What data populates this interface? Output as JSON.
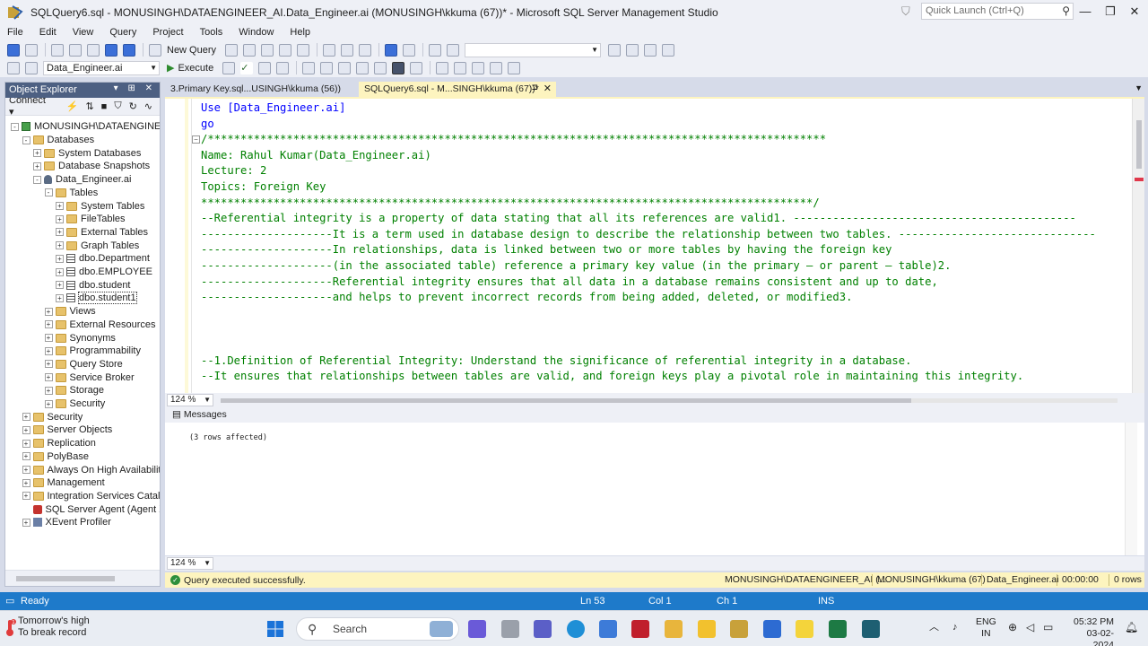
{
  "window": {
    "title": "SQLQuery6.sql - MONUSINGH\\DATAENGINEER_AI.Data_Engineer.ai (MONUSINGH\\kkuma (67))* - Microsoft SQL Server Management Studio",
    "quick_launch_placeholder": "Quick Launch (Ctrl+Q)"
  },
  "menu": [
    "File",
    "Edit",
    "View",
    "Query",
    "Project",
    "Tools",
    "Window",
    "Help"
  ],
  "toolbar": {
    "new_query_label": "New Query",
    "database_selected": "Data_Engineer.ai",
    "execute_label": "Execute"
  },
  "object_explorer": {
    "title": "Object Explorer",
    "connect_label": "Connect",
    "tree": [
      {
        "label": "MONUSINGH\\DATAENGINEER_AI",
        "icon": "server-icon",
        "exp": "-",
        "level": 0
      },
      {
        "label": "Databases",
        "icon": "folder-icon",
        "exp": "-",
        "level": 1
      },
      {
        "label": "System Databases",
        "icon": "folder-icon",
        "exp": "+",
        "level": 2
      },
      {
        "label": "Database Snapshots",
        "icon": "folder-icon",
        "exp": "+",
        "level": 2
      },
      {
        "label": "Data_Engineer.ai",
        "icon": "database-icon",
        "exp": "-",
        "level": 2
      },
      {
        "label": "Tables",
        "icon": "folder-icon",
        "exp": "-",
        "level": 3
      },
      {
        "label": "System Tables",
        "icon": "folder-icon",
        "exp": "+",
        "level": 4
      },
      {
        "label": "FileTables",
        "icon": "folder-icon",
        "exp": "+",
        "level": 4
      },
      {
        "label": "External Tables",
        "icon": "folder-icon",
        "exp": "+",
        "level": 4
      },
      {
        "label": "Graph Tables",
        "icon": "folder-icon",
        "exp": "+",
        "level": 4
      },
      {
        "label": "dbo.Department",
        "icon": "table-icon",
        "exp": "+",
        "level": 4
      },
      {
        "label": "dbo.EMPLOYEE",
        "icon": "table-icon",
        "exp": "+",
        "level": 4
      },
      {
        "label": "dbo.student",
        "icon": "table-icon",
        "exp": "+",
        "level": 4
      },
      {
        "label": "dbo.student1",
        "icon": "table-icon",
        "exp": "+",
        "level": 4,
        "selected": true
      },
      {
        "label": "Views",
        "icon": "folder-icon",
        "exp": "+",
        "level": 3
      },
      {
        "label": "External Resources",
        "icon": "folder-icon",
        "exp": "+",
        "level": 3
      },
      {
        "label": "Synonyms",
        "icon": "folder-icon",
        "exp": "+",
        "level": 3
      },
      {
        "label": "Programmability",
        "icon": "folder-icon",
        "exp": "+",
        "level": 3
      },
      {
        "label": "Query Store",
        "icon": "folder-icon",
        "exp": "+",
        "level": 3
      },
      {
        "label": "Service Broker",
        "icon": "folder-icon",
        "exp": "+",
        "level": 3
      },
      {
        "label": "Storage",
        "icon": "folder-icon",
        "exp": "+",
        "level": 3
      },
      {
        "label": "Security",
        "icon": "folder-icon",
        "exp": "+",
        "level": 3
      },
      {
        "label": "Security",
        "icon": "folder-icon",
        "exp": "+",
        "level": 1
      },
      {
        "label": "Server Objects",
        "icon": "folder-icon",
        "exp": "+",
        "level": 1
      },
      {
        "label": "Replication",
        "icon": "folder-icon",
        "exp": "+",
        "level": 1
      },
      {
        "label": "PolyBase",
        "icon": "folder-icon",
        "exp": "+",
        "level": 1
      },
      {
        "label": "Always On High Availability",
        "icon": "folder-icon",
        "exp": "+",
        "level": 1
      },
      {
        "label": "Management",
        "icon": "folder-icon",
        "exp": "+",
        "level": 1
      },
      {
        "label": "Integration Services Catalogs",
        "icon": "folder-icon",
        "exp": "+",
        "level": 1
      },
      {
        "label": "SQL Server Agent (Agent XPs di",
        "icon": "agent-icon",
        "exp": "",
        "level": 1
      },
      {
        "label": "XEvent Profiler",
        "icon": "xevent-icon",
        "exp": "+",
        "level": 1
      }
    ]
  },
  "tabs": [
    {
      "label": "3.Primary Key.sql...USINGH\\kkuma (56))"
    },
    {
      "label": "SQLQuery6.sql - M...SINGH\\kkuma (67))*"
    }
  ],
  "editor": {
    "lines": [
      {
        "parts": [
          {
            "t": "Use [Data_Engineer.ai]",
            "c": "kw"
          }
        ]
      },
      {
        "parts": [
          {
            "t": "go",
            "c": "kw"
          }
        ]
      },
      {
        "parts": [
          {
            "t": "/**********************************************************************************************",
            "c": "cm"
          }
        ],
        "fold": true
      },
      {
        "parts": [
          {
            "t": "Name: Rahul Kumar(Data_Engineer.ai)",
            "c": "cm"
          }
        ]
      },
      {
        "parts": [
          {
            "t": "Lecture: 2",
            "c": "cm"
          }
        ]
      },
      {
        "parts": [
          {
            "t": "Topics: Foreign Key",
            "c": "cm"
          }
        ]
      },
      {
        "parts": [
          {
            "t": "*********************************************************************************************/",
            "c": "cm"
          }
        ]
      },
      {
        "parts": [
          {
            "t": "--Referential integrity is a property of data stating that all its references are valid1. -------------------------------------------",
            "c": "cm"
          }
        ]
      },
      {
        "parts": [
          {
            "t": "--------------------It is a term used in database design to describe the relationship between two tables. ------------------------------",
            "c": "cm"
          }
        ]
      },
      {
        "parts": [
          {
            "t": "--------------------In relationships, data is linked between two or more tables by having the foreign key",
            "c": "cm"
          }
        ]
      },
      {
        "parts": [
          {
            "t": "--------------------(in the associated table) reference a primary key value (in the primary – or parent – table)2.",
            "c": "cm"
          }
        ]
      },
      {
        "parts": [
          {
            "t": "--------------------Referential integrity ensures that all data in a database remains consistent and up to date,",
            "c": "cm"
          }
        ]
      },
      {
        "parts": [
          {
            "t": "--------------------and helps to prevent incorrect records from being added, deleted, or modified3.",
            "c": "cm"
          }
        ]
      },
      {
        "parts": [
          {
            "t": "",
            "c": "cm"
          }
        ]
      },
      {
        "parts": [
          {
            "t": "",
            "c": "cm"
          }
        ]
      },
      {
        "parts": [
          {
            "t": "",
            "c": "cm"
          }
        ]
      },
      {
        "parts": [
          {
            "t": "--1.Definition of Referential Integrity: Understand the significance of referential integrity in a database.",
            "c": "cm"
          }
        ]
      },
      {
        "parts": [
          {
            "t": "--It ensures that relationships between tables are valid, and foreign keys play a pivotal role in maintaining this integrity.",
            "c": "cm"
          }
        ]
      }
    ],
    "zoom": "124 %"
  },
  "messages": {
    "tab_label": "Messages",
    "text": "(3 rows affected)",
    "zoom": "124 %"
  },
  "query_status": {
    "message": "Query executed successfully.",
    "server": "MONUSINGH\\DATAENGINEER_AI (...",
    "user": "MONUSINGH\\kkuma (67)",
    "database": "Data_Engineer.ai",
    "elapsed": "00:00:00",
    "rows": "0 rows"
  },
  "status_bar": {
    "ready": "Ready",
    "ln": "Ln 53",
    "col": "Col 1",
    "ch": "Ch 1",
    "ins": "INS"
  },
  "taskbar": {
    "weather_line1": "Tomorrow's high",
    "weather_line2": "To break record",
    "weather_badge": "1",
    "search_label": "Search",
    "lang_line1": "ENG",
    "lang_line2": "IN",
    "time": "05:32 PM",
    "date": "03-02-2024"
  }
}
